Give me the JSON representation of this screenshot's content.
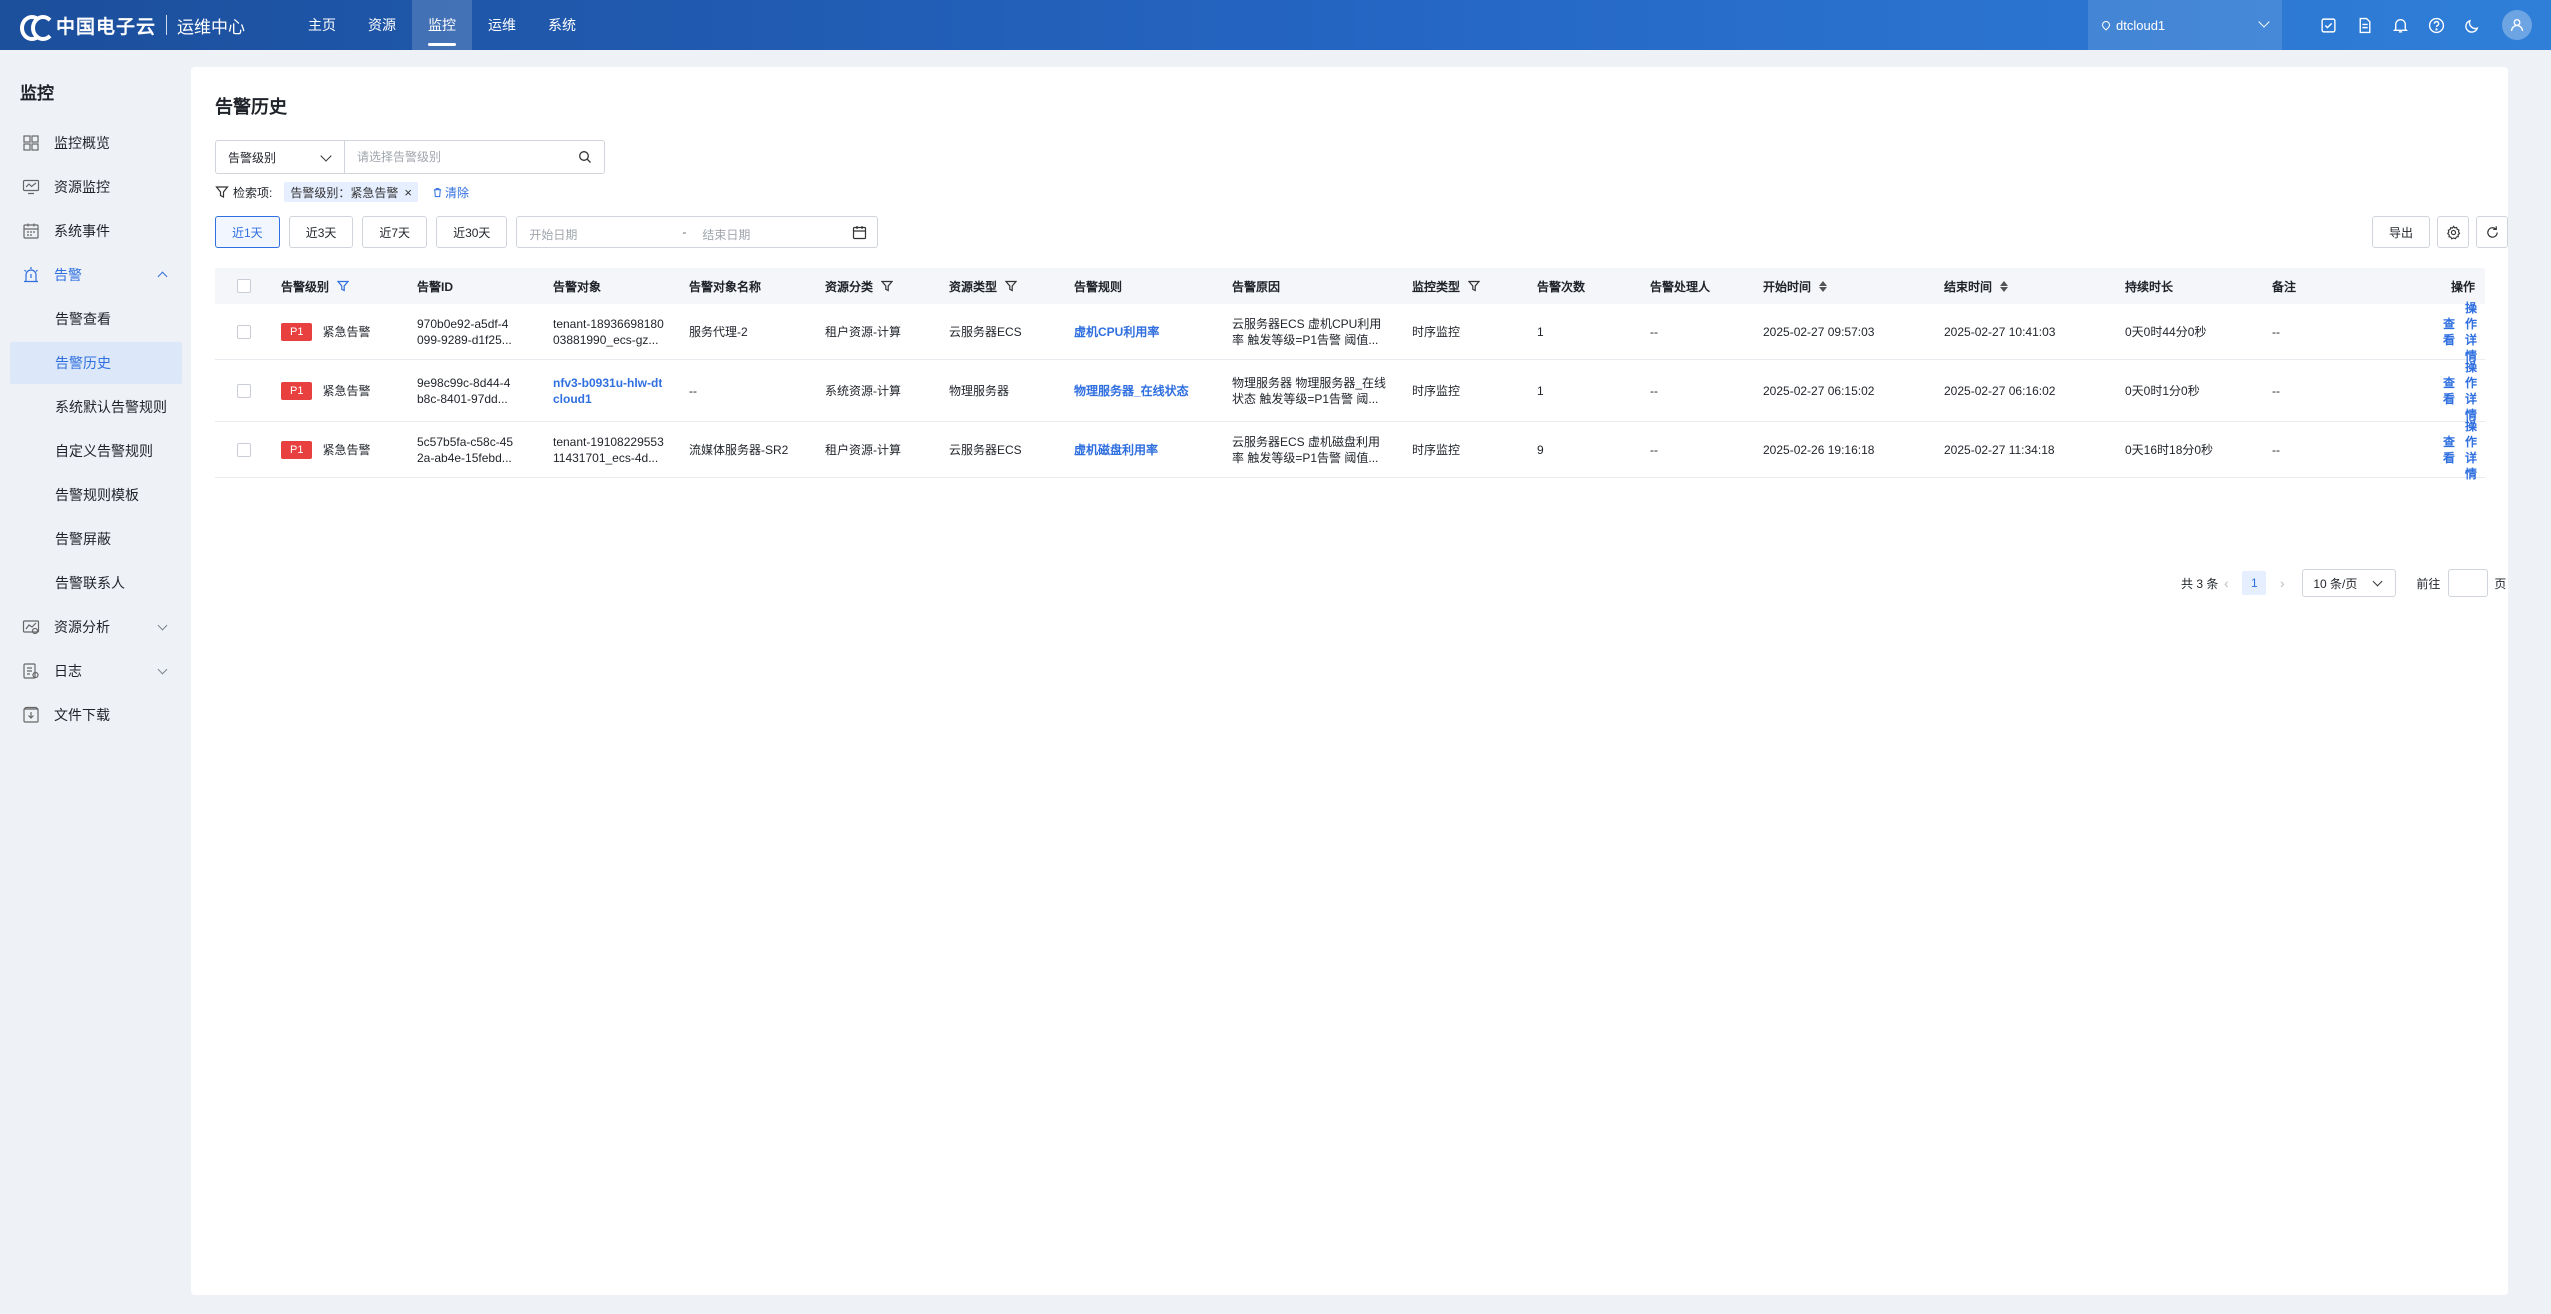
{
  "header": {
    "brand": "中国电子云",
    "product": "运维中心",
    "nav": [
      "主页",
      "资源",
      "监控",
      "运维",
      "系统"
    ],
    "active_nav": "监控",
    "region": "dtcloud1"
  },
  "sidebar": {
    "title": "监控",
    "items": [
      {
        "label": "监控概览",
        "icon": "grid-icon"
      },
      {
        "label": "资源监控",
        "icon": "monitor-icon"
      },
      {
        "label": "系统事件",
        "icon": "calendar-icon"
      },
      {
        "label": "告警",
        "icon": "alarm-icon",
        "expanded": true
      },
      {
        "label": "资源分析",
        "icon": "analysis-icon"
      },
      {
        "label": "日志",
        "icon": "log-icon"
      },
      {
        "label": "文件下载",
        "icon": "download-icon"
      }
    ],
    "alarm_sub": [
      "告警查看",
      "告警历史",
      "系统默认告警规则",
      "自定义告警规则",
      "告警规则模板",
      "告警屏蔽",
      "告警联系人"
    ],
    "active_sub": "告警历史"
  },
  "main": {
    "title": "告警历史",
    "filter": {
      "select_value": "告警级别",
      "placeholder": "请选择告警级别"
    },
    "conditions": {
      "label": "检索项:",
      "tag": "告警级别：紧急告警",
      "clear": "清除"
    },
    "quick": [
      "近1天",
      "近3天",
      "近7天",
      "近30天"
    ],
    "active_quick": "近1天",
    "date": {
      "start_placeholder": "开始日期",
      "sep": "-",
      "end_placeholder": "结束日期"
    },
    "export": "导出"
  },
  "table": {
    "columns": [
      "告警级别",
      "告警ID",
      "告警对象",
      "告警对象名称",
      "资源分类",
      "资源类型",
      "告警规则",
      "告警原因",
      "监控类型",
      "告警次数",
      "告警处理人",
      "开始时间",
      "结束时间",
      "持续时长",
      "备注",
      "操作"
    ],
    "rows": [
      {
        "level": "P1",
        "level_text": "紧急告警",
        "id": [
          "970b0e92-a5df-4",
          "099-9289-d1f25..."
        ],
        "object": [
          "tenant-18936698180",
          "03881990_ecs-gz..."
        ],
        "object_link": false,
        "object_name": "服务代理-2",
        "res_class": "租户资源-计算",
        "res_type": "云服务器ECS",
        "rule": "虚机CPU利用率",
        "reason": [
          "云服务器ECS 虚机CPU利用",
          "率 触发等级=P1告警 阈值..."
        ],
        "monitor_type": "时序监控",
        "count": "1",
        "handler": "--",
        "start": "2025-02-27 09:57:03",
        "end": "2025-02-27 10:41:03",
        "duration": "0天0时44分0秒",
        "note": "--",
        "op_view": "查看",
        "op_detail": "操作详情"
      },
      {
        "level": "P1",
        "level_text": "紧急告警",
        "id": [
          "9e98c99c-8d44-4",
          "b8c-8401-97dd..."
        ],
        "object": [
          "nfv3-b0931u-hlw-dt",
          "cloud1"
        ],
        "object_link": true,
        "object_name": "--",
        "res_class": "系统资源-计算",
        "res_type": "物理服务器",
        "rule": "物理服务器_在线状态",
        "reason": [
          "物理服务器 物理服务器_在线",
          "状态 触发等级=P1告警 阈..."
        ],
        "monitor_type": "时序监控",
        "count": "1",
        "handler": "--",
        "start": "2025-02-27 06:15:02",
        "end": "2025-02-27 06:16:02",
        "duration": "0天0时1分0秒",
        "note": "--",
        "op_view": "查看",
        "op_detail": "操作详情"
      },
      {
        "level": "P1",
        "level_text": "紧急告警",
        "id": [
          "5c57b5fa-c58c-45",
          "2a-ab4e-15febd..."
        ],
        "object": [
          "tenant-19108229553",
          "11431701_ecs-4d..."
        ],
        "object_link": false,
        "object_name": "流媒体服务器-SR2",
        "res_class": "租户资源-计算",
        "res_type": "云服务器ECS",
        "rule": "虚机磁盘利用率",
        "reason": [
          "云服务器ECS 虚机磁盘利用",
          "率 触发等级=P1告警 阈值..."
        ],
        "monitor_type": "时序监控",
        "count": "9",
        "handler": "--",
        "start": "2025-02-26 19:16:18",
        "end": "2025-02-27 11:34:18",
        "duration": "0天16时18分0秒",
        "note": "--",
        "op_view": "查看",
        "op_detail": "操作详情"
      }
    ]
  },
  "pagination": {
    "total": "共 3 条",
    "current": "1",
    "size": "10 条/页",
    "goto": "前往",
    "page": "页"
  },
  "colors": {
    "primary": "#2f6fe0",
    "header": "#2566c4",
    "danger": "#e8403f"
  }
}
